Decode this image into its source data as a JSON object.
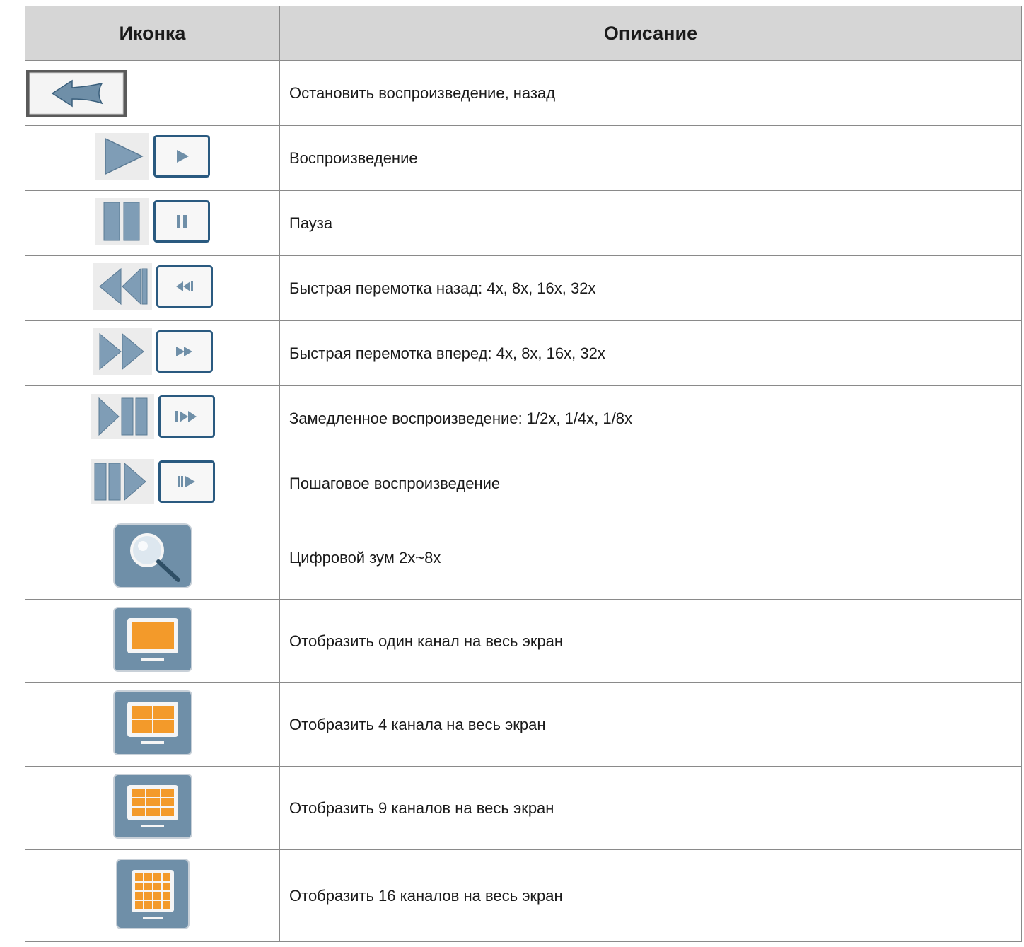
{
  "table": {
    "headers": {
      "icon": "Иконка",
      "description": "Описание"
    },
    "rows": [
      {
        "icons": [
          "back-arrow-button-icon"
        ],
        "description": "Остановить воспроизведение, назад"
      },
      {
        "icons": [
          "play-icon",
          "play-button-icon"
        ],
        "description": "Воспроизведение"
      },
      {
        "icons": [
          "pause-icon",
          "pause-button-icon"
        ],
        "description": "Пауза"
      },
      {
        "icons": [
          "rewind-icon",
          "rewind-button-icon"
        ],
        "description": "Быстрая перемотка назад: 4x, 8x, 16x, 32x"
      },
      {
        "icons": [
          "fast-forward-icon",
          "fast-forward-button-icon"
        ],
        "description": "Быстрая перемотка вперед: 4x, 8x, 16x, 32x"
      },
      {
        "icons": [
          "slow-play-icon",
          "slow-play-button-icon"
        ],
        "description": "Замедленное воспроизведение: 1/2x, 1/4x, 1/8x"
      },
      {
        "icons": [
          "step-play-icon",
          "step-play-button-icon"
        ],
        "description": "Пошаговое воспроизведение"
      },
      {
        "icons": [
          "magnifier-zoom-icon"
        ],
        "description": "Цифровой зум 2x~8x"
      },
      {
        "icons": [
          "monitor-1-channel-icon"
        ],
        "description": "Отобразить один канал на весь экран"
      },
      {
        "icons": [
          "monitor-4-channels-icon"
        ],
        "description": "Отобразить 4 канала на весь экран"
      },
      {
        "icons": [
          "monitor-9-channels-icon"
        ],
        "description": "Отобразить 9 каналов на весь экран"
      },
      {
        "icons": [
          "monitor-16-channels-icon"
        ],
        "description": "Отобразить 16 каналов на весь экран"
      }
    ]
  },
  "colors": {
    "icon_blue": "#6f8fa8",
    "icon_border": "#2a5a80",
    "screen_orange": "#f39a2a",
    "header_bg": "#d6d6d6"
  }
}
